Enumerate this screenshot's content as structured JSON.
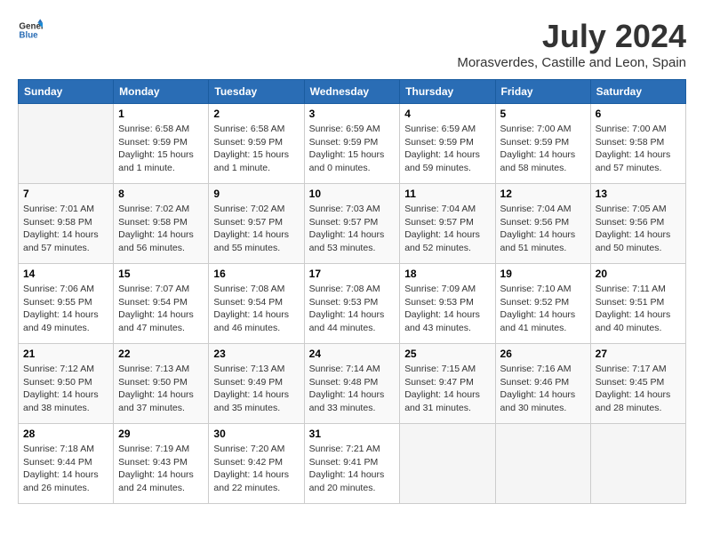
{
  "logo": {
    "general": "General",
    "blue": "Blue"
  },
  "title": "July 2024",
  "location": "Morasverdes, Castille and Leon, Spain",
  "weekdays": [
    "Sunday",
    "Monday",
    "Tuesday",
    "Wednesday",
    "Thursday",
    "Friday",
    "Saturday"
  ],
  "weeks": [
    [
      {
        "day": "",
        "info": ""
      },
      {
        "day": "1",
        "info": "Sunrise: 6:58 AM\nSunset: 9:59 PM\nDaylight: 15 hours\nand 1 minute."
      },
      {
        "day": "2",
        "info": "Sunrise: 6:58 AM\nSunset: 9:59 PM\nDaylight: 15 hours\nand 1 minute."
      },
      {
        "day": "3",
        "info": "Sunrise: 6:59 AM\nSunset: 9:59 PM\nDaylight: 15 hours\nand 0 minutes."
      },
      {
        "day": "4",
        "info": "Sunrise: 6:59 AM\nSunset: 9:59 PM\nDaylight: 14 hours\nand 59 minutes."
      },
      {
        "day": "5",
        "info": "Sunrise: 7:00 AM\nSunset: 9:59 PM\nDaylight: 14 hours\nand 58 minutes."
      },
      {
        "day": "6",
        "info": "Sunrise: 7:00 AM\nSunset: 9:58 PM\nDaylight: 14 hours\nand 57 minutes."
      }
    ],
    [
      {
        "day": "7",
        "info": "Sunrise: 7:01 AM\nSunset: 9:58 PM\nDaylight: 14 hours\nand 57 minutes."
      },
      {
        "day": "8",
        "info": "Sunrise: 7:02 AM\nSunset: 9:58 PM\nDaylight: 14 hours\nand 56 minutes."
      },
      {
        "day": "9",
        "info": "Sunrise: 7:02 AM\nSunset: 9:57 PM\nDaylight: 14 hours\nand 55 minutes."
      },
      {
        "day": "10",
        "info": "Sunrise: 7:03 AM\nSunset: 9:57 PM\nDaylight: 14 hours\nand 53 minutes."
      },
      {
        "day": "11",
        "info": "Sunrise: 7:04 AM\nSunset: 9:57 PM\nDaylight: 14 hours\nand 52 minutes."
      },
      {
        "day": "12",
        "info": "Sunrise: 7:04 AM\nSunset: 9:56 PM\nDaylight: 14 hours\nand 51 minutes."
      },
      {
        "day": "13",
        "info": "Sunrise: 7:05 AM\nSunset: 9:56 PM\nDaylight: 14 hours\nand 50 minutes."
      }
    ],
    [
      {
        "day": "14",
        "info": "Sunrise: 7:06 AM\nSunset: 9:55 PM\nDaylight: 14 hours\nand 49 minutes."
      },
      {
        "day": "15",
        "info": "Sunrise: 7:07 AM\nSunset: 9:54 PM\nDaylight: 14 hours\nand 47 minutes."
      },
      {
        "day": "16",
        "info": "Sunrise: 7:08 AM\nSunset: 9:54 PM\nDaylight: 14 hours\nand 46 minutes."
      },
      {
        "day": "17",
        "info": "Sunrise: 7:08 AM\nSunset: 9:53 PM\nDaylight: 14 hours\nand 44 minutes."
      },
      {
        "day": "18",
        "info": "Sunrise: 7:09 AM\nSunset: 9:53 PM\nDaylight: 14 hours\nand 43 minutes."
      },
      {
        "day": "19",
        "info": "Sunrise: 7:10 AM\nSunset: 9:52 PM\nDaylight: 14 hours\nand 41 minutes."
      },
      {
        "day": "20",
        "info": "Sunrise: 7:11 AM\nSunset: 9:51 PM\nDaylight: 14 hours\nand 40 minutes."
      }
    ],
    [
      {
        "day": "21",
        "info": "Sunrise: 7:12 AM\nSunset: 9:50 PM\nDaylight: 14 hours\nand 38 minutes."
      },
      {
        "day": "22",
        "info": "Sunrise: 7:13 AM\nSunset: 9:50 PM\nDaylight: 14 hours\nand 37 minutes."
      },
      {
        "day": "23",
        "info": "Sunrise: 7:13 AM\nSunset: 9:49 PM\nDaylight: 14 hours\nand 35 minutes."
      },
      {
        "day": "24",
        "info": "Sunrise: 7:14 AM\nSunset: 9:48 PM\nDaylight: 14 hours\nand 33 minutes."
      },
      {
        "day": "25",
        "info": "Sunrise: 7:15 AM\nSunset: 9:47 PM\nDaylight: 14 hours\nand 31 minutes."
      },
      {
        "day": "26",
        "info": "Sunrise: 7:16 AM\nSunset: 9:46 PM\nDaylight: 14 hours\nand 30 minutes."
      },
      {
        "day": "27",
        "info": "Sunrise: 7:17 AM\nSunset: 9:45 PM\nDaylight: 14 hours\nand 28 minutes."
      }
    ],
    [
      {
        "day": "28",
        "info": "Sunrise: 7:18 AM\nSunset: 9:44 PM\nDaylight: 14 hours\nand 26 minutes."
      },
      {
        "day": "29",
        "info": "Sunrise: 7:19 AM\nSunset: 9:43 PM\nDaylight: 14 hours\nand 24 minutes."
      },
      {
        "day": "30",
        "info": "Sunrise: 7:20 AM\nSunset: 9:42 PM\nDaylight: 14 hours\nand 22 minutes."
      },
      {
        "day": "31",
        "info": "Sunrise: 7:21 AM\nSunset: 9:41 PM\nDaylight: 14 hours\nand 20 minutes."
      },
      {
        "day": "",
        "info": ""
      },
      {
        "day": "",
        "info": ""
      },
      {
        "day": "",
        "info": ""
      }
    ]
  ]
}
